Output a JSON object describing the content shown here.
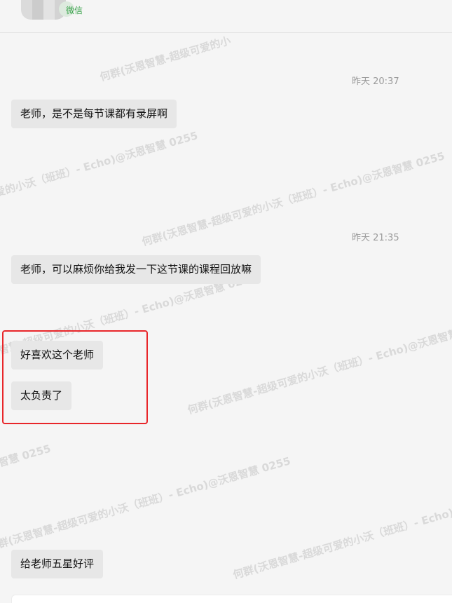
{
  "header": {
    "contact_tag": "微信"
  },
  "messages": [
    {
      "timestamp": "昨天 20:37",
      "text": "老师，是不是每节课都有录屏啊"
    },
    {
      "timestamp": "昨天 21:35",
      "text": "老师，可以麻烦你给我发一下这节课的课程回放嘛"
    },
    {
      "text": "好喜欢这个老师"
    },
    {
      "text": "太负责了"
    },
    {
      "text": "给老师五星好评"
    }
  ],
  "watermark": {
    "text_a": "何群(沃恩智慧-超级可爱的小沃（班班）- Echo)@沃恩智慧 0255",
    "text_b": "何群(沃恩智慧-超级可爱的小",
    "text_c": "爱的小沃（班班）- Echo)@沃恩智慧 0255",
    "text_d": "何群(沃恩智慧-超级可爱的小沃（班班）- Echo)@沃恩智慧 0255",
    "text_e": "(沃恩智慧-超级可爱的小沃（班班）- Echo)@沃恩智慧 0255",
    "text_f": "何群(沃恩智慧-超级可爱的小沃（班班）- Echo)@沃恩智慧 0255",
    "text_g": "智慧 0255",
    "text_h": "何群(沃恩智慧-超级可爱的小沃（班班）- Echo)@沃恩智慧 0255"
  }
}
